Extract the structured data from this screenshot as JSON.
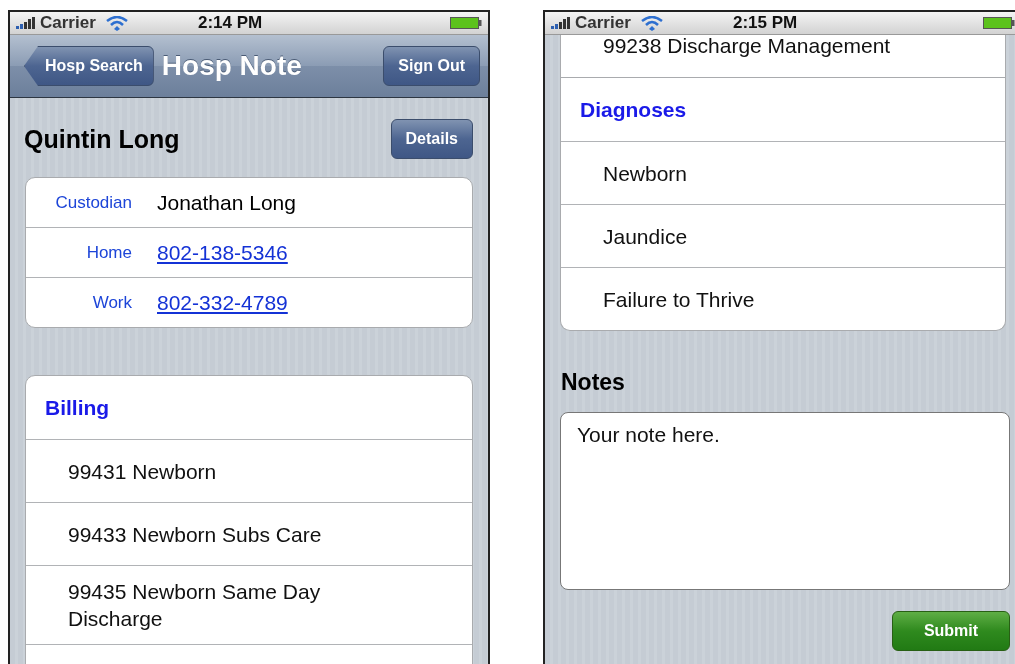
{
  "screens": [
    {
      "status_bar": {
        "carrier": "Carrier",
        "time": "2:14 PM"
      },
      "nav_bar": {
        "back_button": "Hosp Search",
        "title": "Hosp Note",
        "right_button": "Sign Out"
      },
      "patient": {
        "name": "Quintin Long",
        "details_button": "Details"
      },
      "contacts": [
        {
          "label": "Custodian",
          "value": "Jonathan Long",
          "kind": "text"
        },
        {
          "label": "Home",
          "value": "802-138-5346",
          "kind": "link"
        },
        {
          "label": "Work",
          "value": "802-332-4789",
          "kind": "link"
        }
      ],
      "sections": [
        {
          "header": "Billing",
          "rows": [
            "99431 Newborn",
            "99433 Newborn Subs Care",
            "99435 Newborn Same Day Discharge"
          ],
          "continues": true
        }
      ]
    },
    {
      "status_bar": {
        "carrier": "Carrier",
        "time": "2:15 PM"
      },
      "sections": [
        {
          "rows": [
            "99238 Discharge Management"
          ],
          "continues": false
        },
        {
          "header": "Diagnoses",
          "rows": [
            "Newborn",
            "Jaundice",
            "Failure to Thrive"
          ],
          "continues": false
        }
      ],
      "notes": {
        "heading": "Notes",
        "value": "Your note here.",
        "submit_button": "Submit"
      }
    }
  ]
}
